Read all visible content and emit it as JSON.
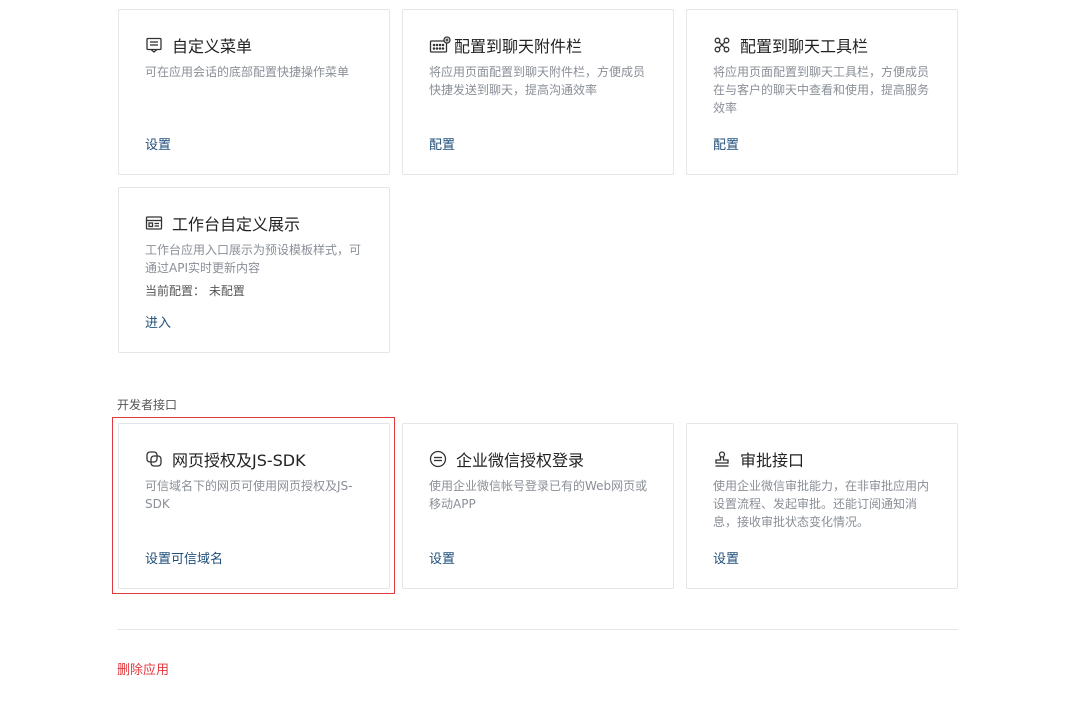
{
  "cards": [
    {
      "title": "自定义菜单",
      "icon": "menu-list-icon",
      "description": "可在应用会话的底部配置快捷操作菜单",
      "link": "设置"
    },
    {
      "title": "配置到聊天附件栏",
      "icon": "chat-attachment-icon",
      "description": "将应用页面配置到聊天附件栏，方便成员快捷发送到聊天，提高沟通效率",
      "link": "配置"
    },
    {
      "title": "配置到聊天工具栏",
      "icon": "chat-toolbar-icon",
      "description": "将应用页面配置到聊天工具栏，方便成员在与客户的聊天中查看和使用，提高服务效率",
      "link": "配置"
    },
    {
      "title": "工作台自定义展示",
      "icon": "workbench-display-icon",
      "description": "工作台应用入口展示为预设模板样式，可通过API实时更新内容",
      "meta": "当前配置：  未配置",
      "link": "进入"
    }
  ],
  "developer_section": {
    "label": "开发者接口",
    "cards": [
      {
        "title": "网页授权及JS-SDK",
        "icon": "web-auth-icon",
        "description": "可信域名下的网页可使用网页授权及JS-SDK",
        "link": "设置可信域名"
      },
      {
        "title": "企业微信授权登录",
        "icon": "wecom-login-icon",
        "description": "使用企业微信帐号登录已有的Web网页或移动APP",
        "link": "设置"
      },
      {
        "title": "审批接口",
        "icon": "approval-stamp-icon",
        "description": "使用企业微信审批能力，在非审批应用内设置流程、发起审批。还能订阅通知消息，接收审批状态变化情况。",
        "link": "设置"
      }
    ]
  },
  "footer": {
    "delete_label": "删除应用"
  },
  "colors": {
    "link": "#1f4e79",
    "danger": "#e0393e",
    "border": "#e3e5e8"
  }
}
